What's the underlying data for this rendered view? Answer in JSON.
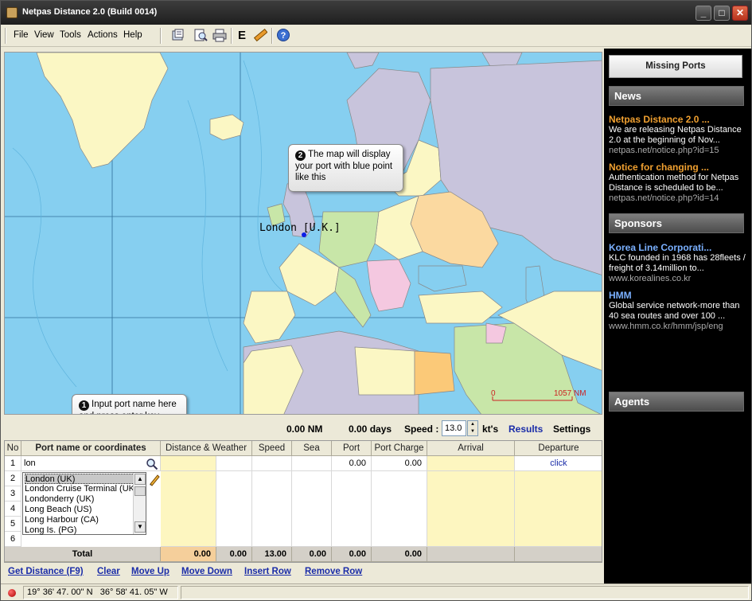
{
  "window": {
    "title": "Netpas Distance 2.0 (Build 0014)"
  },
  "menu": [
    {
      "label": "File"
    },
    {
      "label": "View"
    },
    {
      "label": "Tools"
    },
    {
      "label": "Actions"
    },
    {
      "label": "Help"
    }
  ],
  "toolbar": {
    "e_label": "E"
  },
  "map": {
    "callout_map": {
      "number": "2",
      "text": "The map will display your port with blue point like this"
    },
    "callout_input": {
      "number": "1",
      "text": "Input port name here and press enter key"
    },
    "port_label": "London [U.K.]",
    "scale_start": "0",
    "scale_end": "1057 NM",
    "colors": {
      "sea": "#86cff0"
    }
  },
  "right_panel": {
    "missing_ports": "Missing Ports",
    "news_header": "News",
    "news": [
      {
        "title": "Netpas Distance 2.0 ...",
        "body": "We are releasing Netpas Distance 2.0 at the beginning of Nov...",
        "link": "netpas.net/notice.php?id=15"
      },
      {
        "title": "Notice for changing ...",
        "body": "Authentication method for Netpas Distance is scheduled to be...",
        "link": "netpas.net/notice.php?id=14"
      }
    ],
    "sponsors_header": "Sponsors",
    "sponsors": [
      {
        "title": "Korea Line Corporati...",
        "body": "KLC founded in 1968 has 28fleets / freight of 3.14million to...",
        "link": "www.korealines.co.kr"
      },
      {
        "title": "HMM",
        "body": "Global service network-more than 40 sea routes and over 100 ...",
        "link": "www.hmm.co.kr/hmm/jsp/eng"
      }
    ],
    "agents_header": "Agents"
  },
  "summary": {
    "distance": "0.00 NM",
    "days": "0.00 days",
    "speed_label": "Speed :",
    "speed_value": "13.0",
    "speed_unit": "kt's",
    "results": "Results",
    "settings": "Settings"
  },
  "grid": {
    "headers": [
      "No",
      "Port name or coordinates",
      "Distance & Weather",
      "Speed",
      "Sea",
      "Port",
      "Port Charge",
      "Arrival",
      "Departure"
    ],
    "rows": [
      "1",
      "2",
      "3",
      "4",
      "5",
      "6"
    ],
    "input_value": "lon",
    "row1_port": "0.00",
    "row1_charge": "0.00",
    "row1_departure": "click",
    "dropdown": [
      "London (UK)",
      "London Cruise Terminal (UK)",
      "Londonderry (UK)",
      "Long Beach (US)",
      "Long Harbour (CA)",
      "Long Is. (PG)"
    ],
    "total_label": "Total",
    "totals": [
      "0.00",
      "0.00",
      "13.00",
      "0.00",
      "0.00",
      "0.00"
    ]
  },
  "actions": [
    "Get Distance (F9)",
    "Clear",
    "Move Up",
    "Move Down",
    "Insert Row",
    "Remove Row"
  ],
  "status": {
    "lat": "19° 36' 47. 00\" N",
    "lon": "36° 58' 41. 05\" W"
  }
}
